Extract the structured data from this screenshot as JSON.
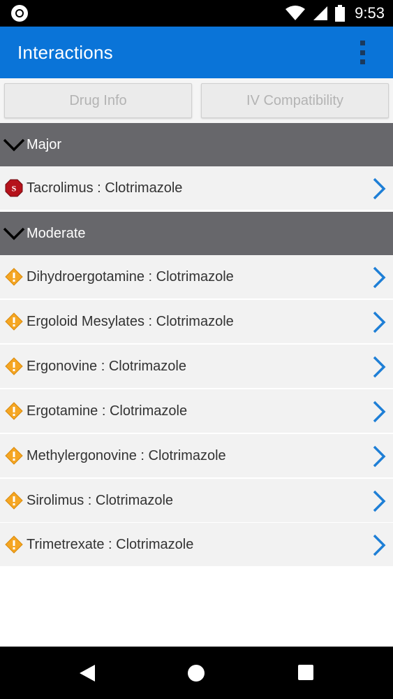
{
  "status_bar": {
    "time": "9:53",
    "icons": [
      "circle-notification-icon",
      "wifi-icon",
      "signal-icon",
      "battery-icon"
    ]
  },
  "app_bar": {
    "title": "Interactions",
    "menu_icon": "overflow-menu-icon"
  },
  "tabs": {
    "drug_info": "Drug Info",
    "iv_compatibility": "IV Compatibility"
  },
  "sections": [
    {
      "title": "Major",
      "severity_icon": "stop-sign-icon",
      "items": [
        "Tacrolimus : Clotrimazole"
      ]
    },
    {
      "title": "Moderate",
      "severity_icon": "warning-diamond-icon",
      "items": [
        "Dihydroergotamine : Clotrimazole",
        "Ergoloid Mesylates : Clotrimazole",
        "Ergonovine : Clotrimazole",
        "Ergotamine : Clotrimazole",
        "Methylergonovine : Clotrimazole",
        "Sirolimus : Clotrimazole",
        "Trimetrexate : Clotrimazole"
      ]
    }
  ],
  "colors": {
    "app_bar": "#0a74d8",
    "section_header": "#67676b",
    "row_bg": "#f2f2f2",
    "chevron": "#1e7fd6",
    "major": "#b5121b",
    "moderate": "#f5a623"
  },
  "stop_sign_letter": "S",
  "nav_bar": {
    "icons": [
      "back-icon",
      "home-icon",
      "recents-icon"
    ]
  }
}
